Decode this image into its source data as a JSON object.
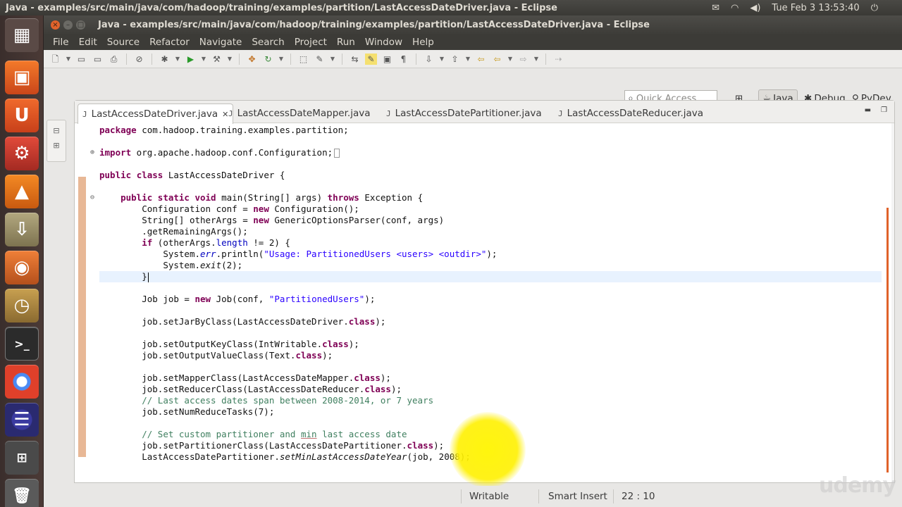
{
  "panel": {
    "title": "Java - examples/src/main/java/com/hadoop/training/examples/partition/LastAccessDateDriver.java - Eclipse",
    "clock": "Tue Feb  3 13:53:40"
  },
  "window": {
    "title": "Java - examples/src/main/java/com/hadoop/training/examples/partition/LastAccessDateDriver.java - Eclipse"
  },
  "menu": [
    "File",
    "Edit",
    "Source",
    "Refactor",
    "Navigate",
    "Search",
    "Project",
    "Run",
    "Window",
    "Help"
  ],
  "quick_access": {
    "placeholder": "Quick Access"
  },
  "perspectives": {
    "java": "Java",
    "debug": "Debug",
    "pydev": "PyDev"
  },
  "tabs": [
    "LastAccessDateDriver.java",
    "LastAccessDateMapper.java",
    "LastAccessDatePartitioner.java",
    "LastAccessDateReducer.java"
  ],
  "code": {
    "l1": [
      "package",
      " com.hadoop.training.examples.partition;"
    ],
    "l2": [
      "import",
      " org.apache.hadoop.conf.Configuration;"
    ],
    "l3": [
      "public",
      "class",
      " LastAccessDateDriver {"
    ],
    "l4": [
      "public",
      "static",
      "void",
      " main(String[] args) ",
      "throws",
      " Exception {"
    ],
    "l5": [
      "Configuration conf = ",
      "new",
      " Configuration();"
    ],
    "l6": [
      "String[] otherArgs = ",
      "new",
      " GenericOptionsParser(conf, args)"
    ],
    "l7": [
      ".getRemainingArgs();"
    ],
    "l8": [
      "if",
      " (otherArgs.",
      "length",
      " != 2) {"
    ],
    "l9": [
      "System.",
      "err",
      ".println(",
      "\"Usage: PartitionedUsers <users> <outdir>\"",
      ");"
    ],
    "l10": [
      "System.",
      "exit",
      "(2);"
    ],
    "l11": [
      "}"
    ],
    "l12": [
      "Job job = ",
      "new",
      " Job(conf, ",
      "\"PartitionedUsers\"",
      ");"
    ],
    "l13": [
      "job.setJarByClass(LastAccessDateDriver.",
      "class",
      ");"
    ],
    "l14": [
      "job.setOutputKeyClass(IntWritable.",
      "class",
      ");"
    ],
    "l15": [
      "job.setOutputValueClass(Text.",
      "class",
      ");"
    ],
    "l16": [
      "job.setMapperClass(LastAccessDateMapper.",
      "class",
      ");"
    ],
    "l17": [
      "job.setReducerClass(LastAccessDateReducer.",
      "class",
      ");"
    ],
    "l18": [
      "// Last access dates span between 2008-2014, or 7 years"
    ],
    "l19": [
      "job.setNumReduceTasks(7);"
    ],
    "l20": [
      "// Set custom partitioner and ",
      "min",
      " last access date"
    ],
    "l21": [
      "job.setPartitionerClass(LastAccessDatePartitioner.",
      "class",
      ");"
    ],
    "l22": [
      "LastAccessDatePartitioner.",
      "setMinLastAccessDateYear",
      "(job, 2008);"
    ]
  },
  "status": {
    "writable": "Writable",
    "insert": "Smart Insert",
    "position": "22 : 10"
  },
  "watermark": "udemy"
}
